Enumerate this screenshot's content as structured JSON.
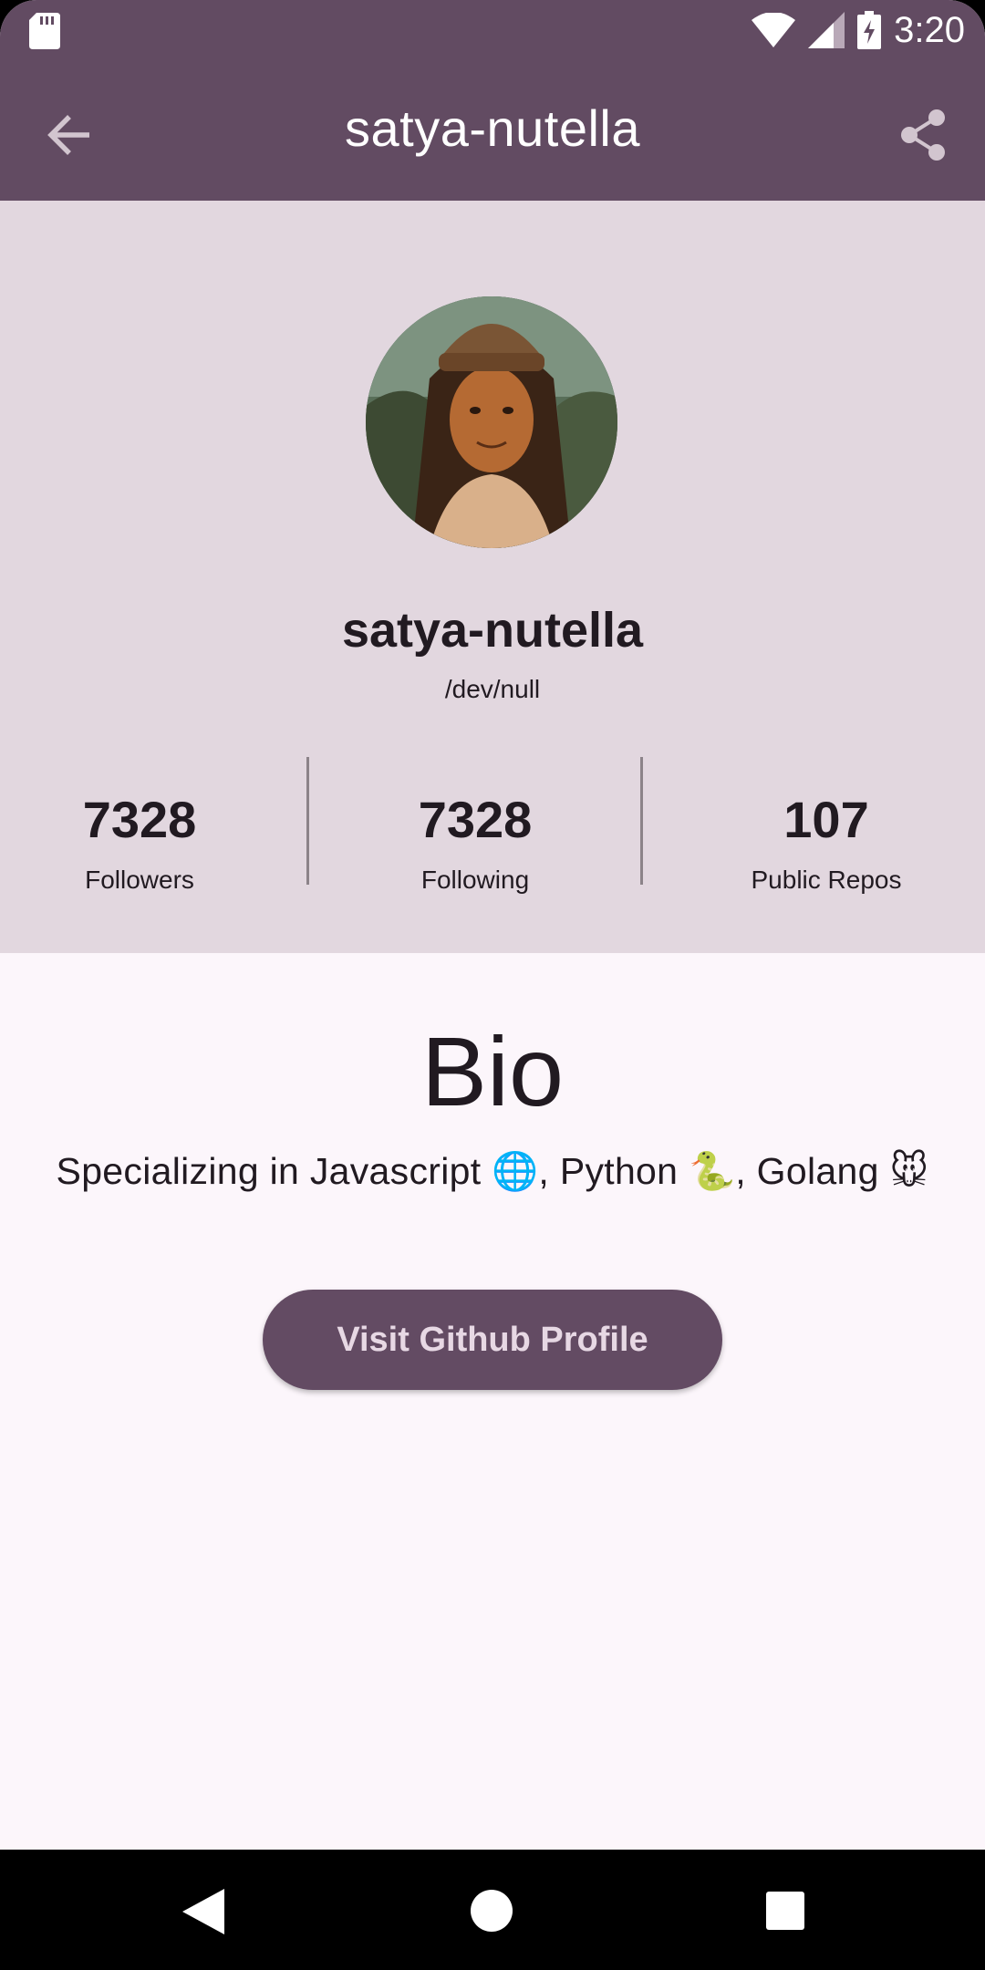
{
  "status_bar": {
    "time": "3:20",
    "icons": [
      "sd-card-icon",
      "wifi-icon",
      "signal-icon",
      "battery-charging-icon"
    ]
  },
  "app_bar": {
    "title": "satya-nutella",
    "back_icon": "arrow-back-icon",
    "share_icon": "share-icon"
  },
  "profile": {
    "username": "satya-nutella",
    "company": "/dev/null",
    "stats": [
      {
        "value": "7328",
        "label": "Followers"
      },
      {
        "value": "7328",
        "label": "Following"
      },
      {
        "value": "107",
        "label": "Public Repos"
      }
    ]
  },
  "bio": {
    "title": "Bio",
    "text": "Specializing in Javascript 🌐, Python 🐍, Golang 🐭"
  },
  "actions": {
    "visit_label": "Visit Github Profile"
  },
  "colors": {
    "primary": "#624b62",
    "header_bg": "#e2d7df",
    "page_bg": "#fcf6fb",
    "button_text": "#e7d8e4"
  }
}
